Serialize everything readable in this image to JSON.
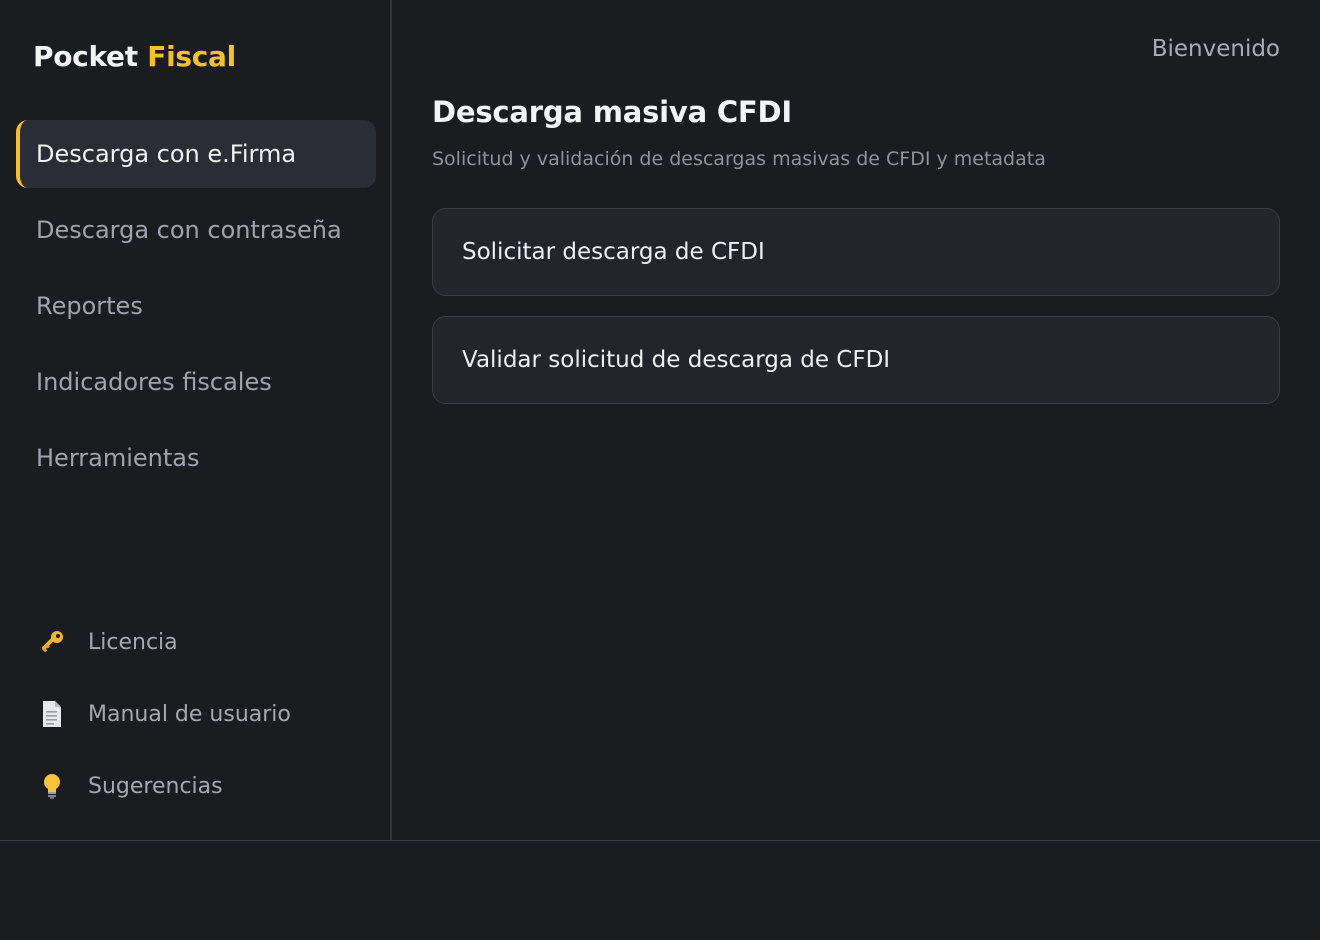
{
  "brand": {
    "part1": "Pocket",
    "part2": "Fiscal",
    "accent_color": "#f4c02e"
  },
  "sidebar": {
    "items": [
      {
        "label": "Descarga con e.Firma",
        "active": true
      },
      {
        "label": "Descarga con contraseña",
        "active": false
      },
      {
        "label": "Reportes",
        "active": false
      },
      {
        "label": "Indicadores fiscales",
        "active": false
      },
      {
        "label": "Herramientas",
        "active": false
      }
    ],
    "bottom_links": [
      {
        "label": "Licencia",
        "icon": "key-icon"
      },
      {
        "label": "Manual de usuario",
        "icon": "document-icon"
      },
      {
        "label": "Sugerencias",
        "icon": "lightbulb-icon"
      }
    ]
  },
  "header": {
    "welcome": "Bienvenido"
  },
  "main": {
    "title": "Descarga masiva CFDI",
    "subtitle": "Solicitud y validación de descargas masivas de CFDI y metadata",
    "cards": [
      {
        "label": "Solicitar descarga de CFDI"
      },
      {
        "label": "Validar solicitud de descarga de CFDI"
      }
    ]
  }
}
